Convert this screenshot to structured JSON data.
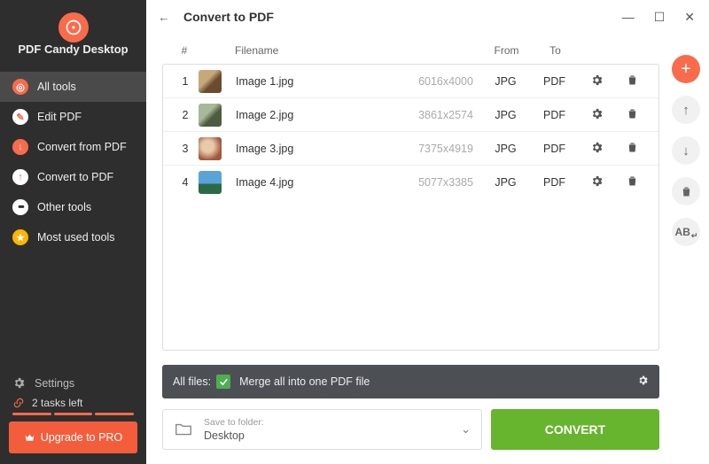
{
  "app": {
    "name": "PDF Candy Desktop"
  },
  "sidebar": {
    "items": [
      {
        "label": "All tools"
      },
      {
        "label": "Edit PDF"
      },
      {
        "label": "Convert from PDF"
      },
      {
        "label": "Convert to PDF"
      },
      {
        "label": "Other tools"
      },
      {
        "label": "Most used tools"
      }
    ],
    "settings_label": "Settings",
    "tasks_label": "2 tasks left",
    "upgrade_label": "Upgrade to PRO"
  },
  "page": {
    "title": "Convert to PDF",
    "headers": {
      "num": "#",
      "filename": "Filename",
      "from": "From",
      "to": "To"
    },
    "files": [
      {
        "num": "1",
        "name": "Image 1.jpg",
        "dim": "6016x4000",
        "from": "JPG",
        "to": "PDF"
      },
      {
        "num": "2",
        "name": "Image 2.jpg",
        "dim": "3861x2574",
        "from": "JPG",
        "to": "PDF"
      },
      {
        "num": "3",
        "name": "Image 3.jpg",
        "dim": "7375x4919",
        "from": "JPG",
        "to": "PDF"
      },
      {
        "num": "4",
        "name": "Image 4.jpg",
        "dim": "5077x3385",
        "from": "JPG",
        "to": "PDF"
      }
    ],
    "merge": {
      "all_files": "All files:",
      "label": "Merge all into one PDF file"
    },
    "output": {
      "hint": "Save to folder:",
      "folder": "Desktop"
    },
    "convert_label": "CONVERT",
    "rail": {
      "ab": "AB"
    }
  }
}
